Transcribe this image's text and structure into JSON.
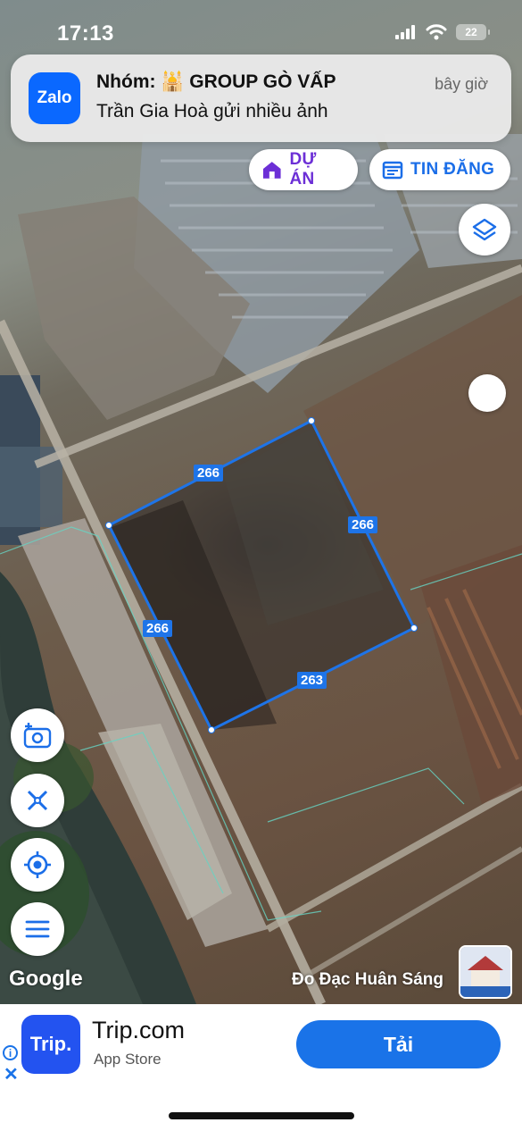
{
  "status": {
    "time": "17:13",
    "battery": "22"
  },
  "notification": {
    "app_icon_label": "Zalo",
    "title": "Nhóm: 🕌 GROUP GÒ VẤP",
    "body": "Trần Gia Hoà gửi nhiều ảnh",
    "time": "bây giờ"
  },
  "toolbar": {
    "projects_label": "DỰ ÁN",
    "listings_label": "TIN ĐĂNG"
  },
  "map": {
    "lot_edges": [
      "266",
      "266",
      "266",
      "263"
    ],
    "google_label": "Google",
    "owner_label": "Đo Đạc Huân Sáng",
    "boundary_color": "#1e74e8"
  },
  "controls": [
    "camera-add",
    "measure-tools",
    "my-location",
    "menu"
  ],
  "ad": {
    "logo_text": "Trip.",
    "app_name": "Trip.com",
    "store": "App Store",
    "cta_label": "Tải"
  }
}
